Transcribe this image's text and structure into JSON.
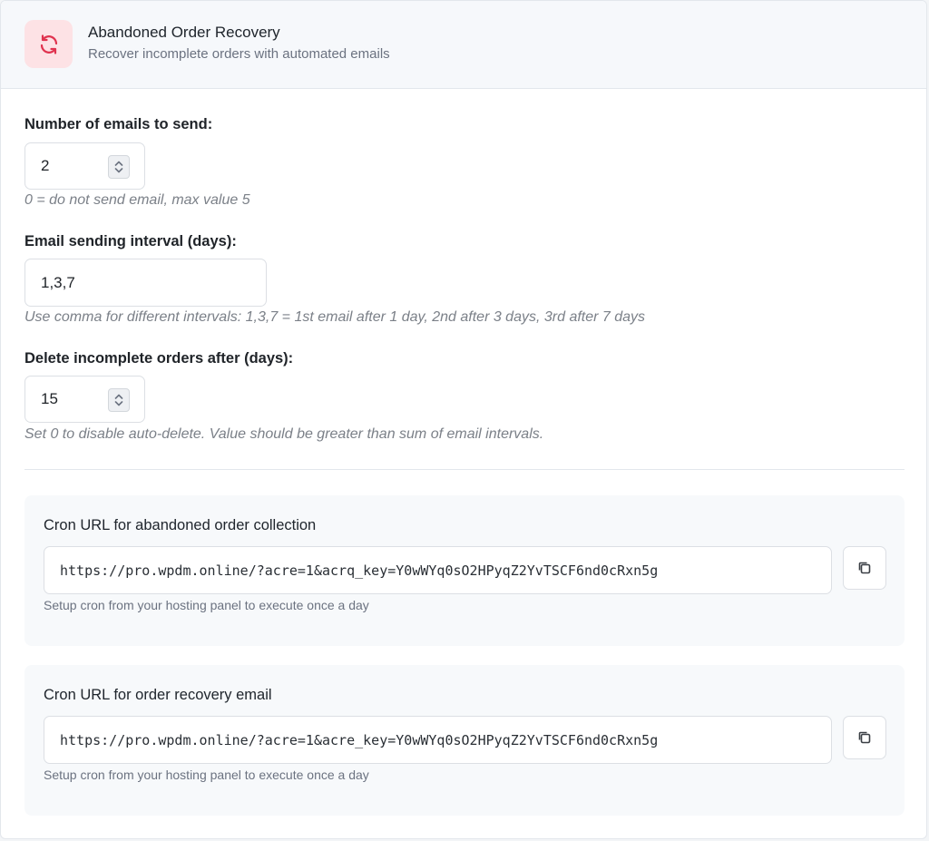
{
  "header": {
    "title": "Abandoned Order Recovery",
    "subtitle": "Recover incomplete orders with automated emails",
    "icon": "refresh-icon",
    "icon_color": "#e0334f"
  },
  "fields": {
    "emails_count": {
      "label": "Number of emails to send:",
      "value": "2",
      "help": "0 = do not send email, max value 5"
    },
    "interval": {
      "label": "Email sending interval (days):",
      "value": "1,3,7",
      "help": "Use comma for different intervals: 1,3,7 = 1st email after 1 day, 2nd after 3 days, 3rd after 7 days"
    },
    "delete_after": {
      "label": "Delete incomplete orders after (days):",
      "value": "15",
      "help": "Set 0 to disable auto-delete. Value should be greater than sum of email intervals."
    }
  },
  "cron": {
    "collection": {
      "title": "Cron URL for abandoned order collection",
      "url": "https://pro.wpdm.online/?acre=1&acrq_key=Y0wWYq0sO2HPyqZ2YvTSCF6nd0cRxn5g",
      "help": "Setup cron from your hosting panel to execute once a day",
      "copy_icon": "copy-icon"
    },
    "recovery": {
      "title": "Cron URL for order recovery email",
      "url": "https://pro.wpdm.online/?acre=1&acre_key=Y0wWYq0sO2HPyqZ2YvTSCF6nd0cRxn5g",
      "help": "Setup cron from your hosting panel to execute once a day",
      "copy_icon": "copy-icon"
    }
  }
}
